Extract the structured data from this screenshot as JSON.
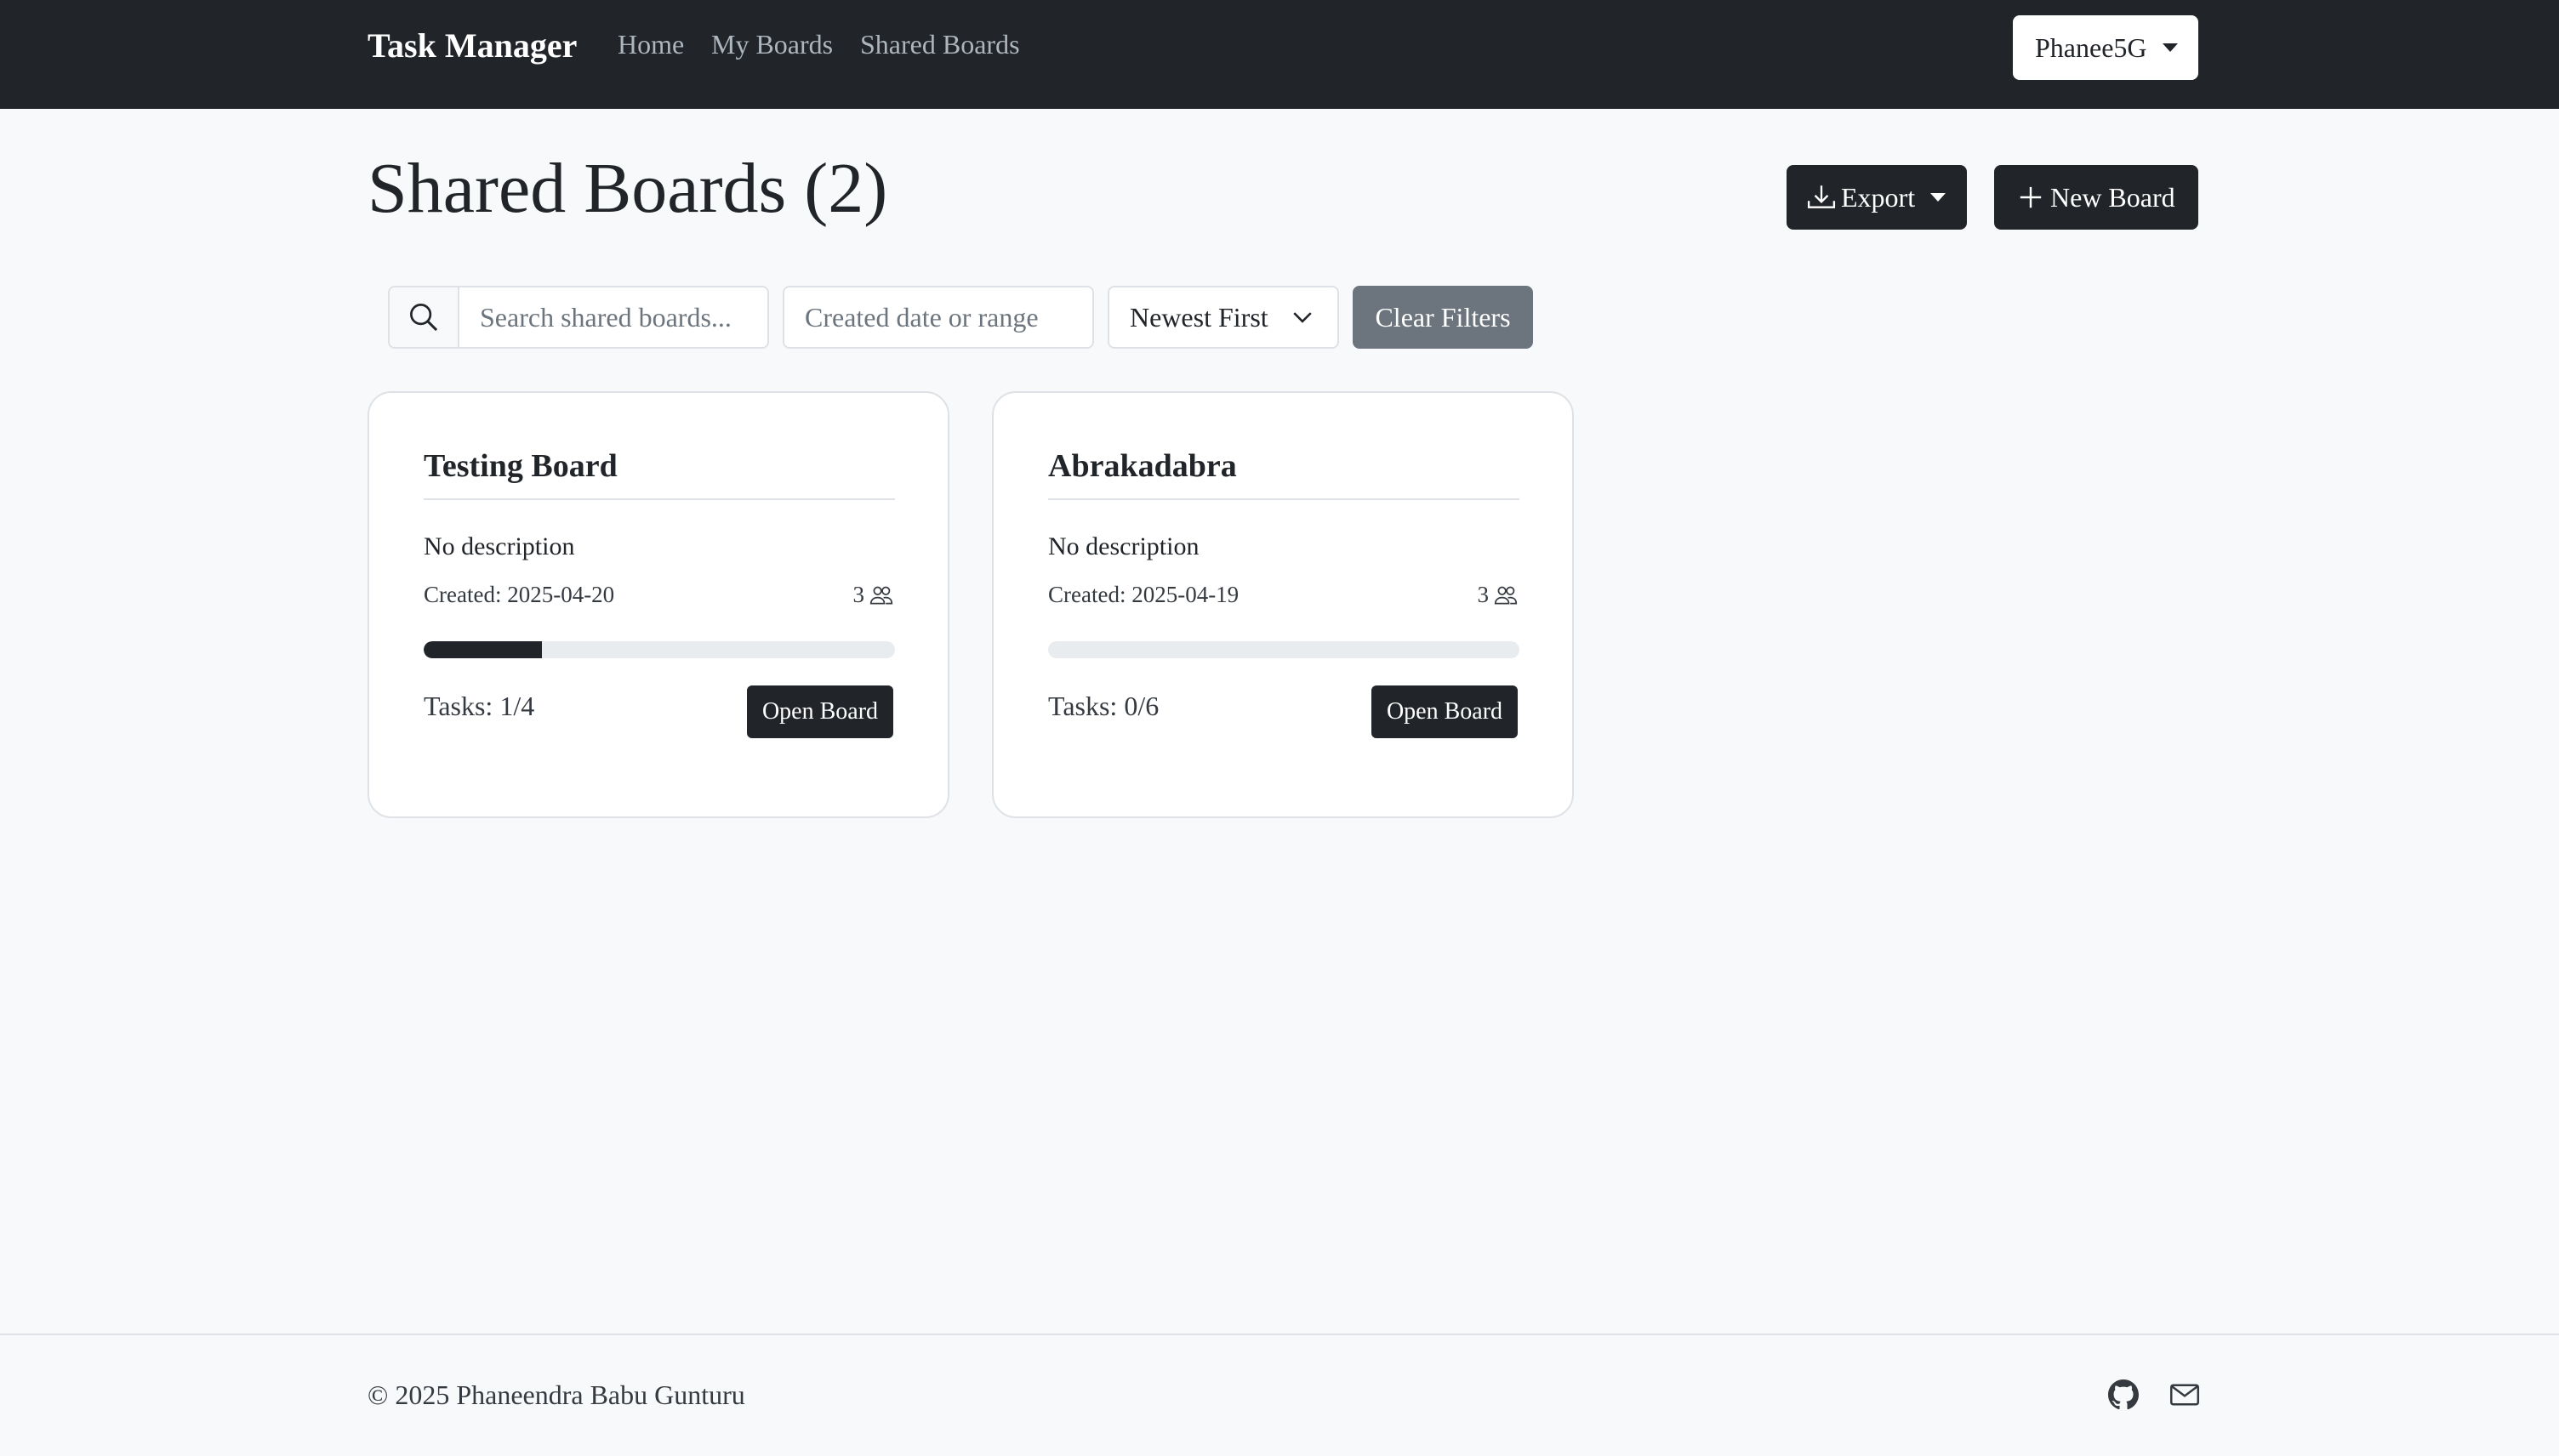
{
  "navbar": {
    "brand": "Task Manager",
    "links": [
      "Home",
      "My Boards",
      "Shared Boards"
    ],
    "user": "Phanee5G"
  },
  "header": {
    "title": "Shared Boards (2)",
    "export_label": "Export",
    "new_board_label": "New Board"
  },
  "filters": {
    "search_placeholder": "Search shared boards...",
    "date_placeholder": "Created date or range",
    "sort_value": "Newest First",
    "clear_label": "Clear Filters"
  },
  "boards": [
    {
      "title": "Testing Board",
      "description": "No description",
      "created": "Created: 2025-04-20",
      "members": "3",
      "progress": 0.25,
      "tasks": "Tasks: 1/4",
      "open_label": "Open Board"
    },
    {
      "title": "Abrakadabra",
      "description": "No description",
      "created": "Created: 2025-04-19",
      "members": "3",
      "progress": 0,
      "tasks": "Tasks: 0/6",
      "open_label": "Open Board"
    }
  ],
  "footer": {
    "copyright": "© 2025 Phaneendra Babu Gunturu",
    "icons": [
      "github-icon",
      "envelope-icon"
    ]
  },
  "colors": {
    "navbar": "#212529",
    "background": "#f8f9fa",
    "primary_button": "#212529",
    "secondary_button": "#6c757d"
  }
}
